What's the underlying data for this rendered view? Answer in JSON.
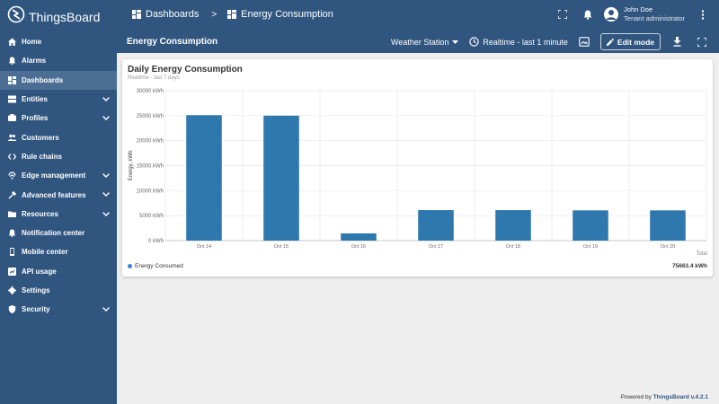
{
  "app": {
    "name": "ThingsBoard"
  },
  "breadcrumb": {
    "parent": "Dashboards",
    "separator": ">",
    "current": "Energy Consumption"
  },
  "user": {
    "name": "John Doe",
    "role": "Tenant administrator"
  },
  "sidebar": {
    "items": [
      {
        "label": "Home",
        "icon": "home-icon",
        "expandable": false,
        "active": false
      },
      {
        "label": "Alarms",
        "icon": "alarm-icon",
        "expandable": false,
        "active": false
      },
      {
        "label": "Dashboards",
        "icon": "dashboard-icon",
        "expandable": false,
        "active": true
      },
      {
        "label": "Entities",
        "icon": "entities-icon",
        "expandable": true,
        "active": false
      },
      {
        "label": "Profiles",
        "icon": "profiles-icon",
        "expandable": true,
        "active": false
      },
      {
        "label": "Customers",
        "icon": "customers-icon",
        "expandable": false,
        "active": false
      },
      {
        "label": "Rule chains",
        "icon": "rule-chains-icon",
        "expandable": false,
        "active": false
      },
      {
        "label": "Edge management",
        "icon": "edge-icon",
        "expandable": true,
        "active": false
      },
      {
        "label": "Advanced features",
        "icon": "advanced-icon",
        "expandable": true,
        "active": false
      },
      {
        "label": "Resources",
        "icon": "resources-icon",
        "expandable": true,
        "active": false
      },
      {
        "label": "Notification center",
        "icon": "notification-icon",
        "expandable": false,
        "active": false
      },
      {
        "label": "Mobile center",
        "icon": "mobile-icon",
        "expandable": false,
        "active": false
      },
      {
        "label": "API usage",
        "icon": "api-usage-icon",
        "expandable": false,
        "active": false
      },
      {
        "label": "Settings",
        "icon": "settings-icon",
        "expandable": false,
        "active": false
      },
      {
        "label": "Security",
        "icon": "security-icon",
        "expandable": true,
        "active": false
      }
    ]
  },
  "dashboard": {
    "title": "Energy Consumption",
    "entity": "Weather Station",
    "timewindow": "Realtime - last 1 minute",
    "edit_label": "Edit mode"
  },
  "widget": {
    "title": "Daily Energy Consumption",
    "subtitle": "Realtime - last 7 days",
    "legend_label": "Energy Consumed",
    "total_label": "Total",
    "total_value": "75663.4 kWh"
  },
  "chart_data": {
    "type": "bar",
    "categories": [
      "Oct 14",
      "Oct 15",
      "Oct 16",
      "Oct 17",
      "Oct 18",
      "Oct 19",
      "Oct 20"
    ],
    "series": [
      {
        "name": "Energy Consumed",
        "values": [
          25100,
          25000,
          1450,
          6100,
          6100,
          6050,
          6050
        ]
      }
    ],
    "ylabel": "Energy, kWh",
    "yticks": [
      "0 kWh",
      "5000 kWh",
      "10000 kWh",
      "15000 kWh",
      "20000 kWh",
      "25000 kWh",
      "30000 kWh"
    ],
    "ylim": [
      0,
      30000
    ],
    "grid": true,
    "legend": "bottom-left",
    "bar_color": "#2e78ae"
  },
  "footer": {
    "prefix": "Powered by",
    "brand": "ThingsBoard v.4.2.1"
  },
  "colors": {
    "primary": "#305680",
    "active": "#4c6e95",
    "background": "#eeeeee"
  }
}
